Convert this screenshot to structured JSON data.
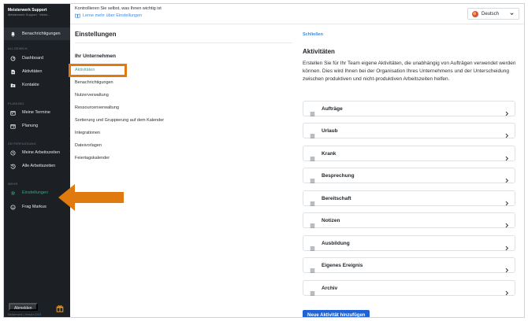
{
  "brand": {
    "name": "Meisterwerk Support",
    "subtitle": "Meisterwerk Support · Meist..."
  },
  "sidebar": {
    "top_item": "Benachrichtigungen",
    "sections": [
      {
        "title": "ALLGEMEIN",
        "items": [
          "Dashboard",
          "Aktivitäten",
          "Kontakte"
        ]
      },
      {
        "title": "PLANUNG",
        "items": [
          "Meine Termine",
          "Planung"
        ]
      },
      {
        "title": "ZEITERFASSUNG",
        "items": [
          "Meine Arbeitszeiten",
          "Alle Arbeitszeiten"
        ]
      },
      {
        "title": "MEHR",
        "items": [
          "Einstellungen",
          "Frag Markus"
        ]
      }
    ],
    "active_item": "Einstellungen",
    "logout_label": "Abmelden",
    "footer": {
      "text": "Meisterwerk | Version",
      "version": "2.0.0"
    }
  },
  "topbar": {
    "promo_text": "Kontrollieren Sie selbst, was Ihnen wichtig ist",
    "promo_link": "Lerne mehr über Einstellungen",
    "language": "Deutsch"
  },
  "settings": {
    "title": "Einstellungen",
    "group_title": "Ihr Unternehmen",
    "items": [
      "Aktivitäten",
      "Benachrichtigungen",
      "Nutzerverwaltung",
      "Ressourcenverwaltung",
      "Sortierung und Gruppierung auf dem Kalender",
      "Integrationen",
      "Dateivorlagen",
      "Feiertagskalender"
    ],
    "selected": "Aktivitäten"
  },
  "activities": {
    "close_label": "Schließen",
    "title": "Aktivitäten",
    "description": "Erstellen Sie für Ihr Team eigene Aktivitäten, die unabhängig von Aufträgen verwendet werden können. Dies wird Ihnen bei der Organisation Ihres Unternehmens und der Unterscheidung zwischen produktiven und nicht-produktiven Arbeitszeiten helfen.",
    "items": [
      "Aufträge",
      "Urlaub",
      "Krank",
      "Besprechung",
      "Bereitschaft",
      "Notizen",
      "Ausbildung",
      "Eigenes Ereignis",
      "Archiv"
    ],
    "add_button": "Neue Aktivität hinzufügen"
  },
  "colors": {
    "accent_green": "#27ae84",
    "link_blue": "#3a8dde",
    "primary_button": "#1f63d6",
    "annotation_orange": "#e07a0f",
    "sidebar_bg": "#1c2024"
  }
}
